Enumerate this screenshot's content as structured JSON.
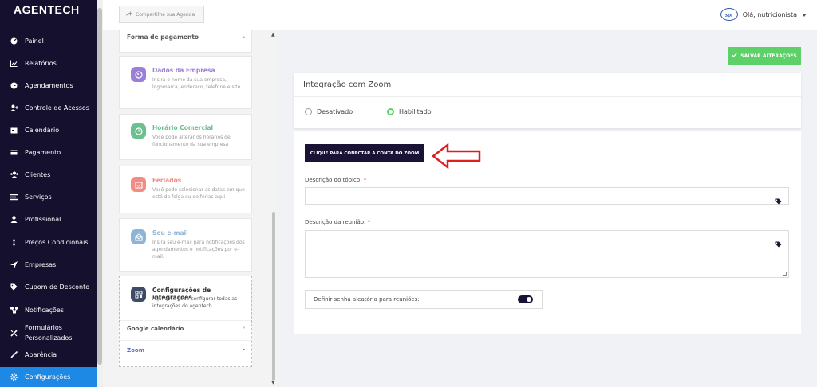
{
  "sidebar": {
    "brand": "AGENTECH",
    "items": [
      {
        "label": "Painel",
        "icon": "dashboard-icon"
      },
      {
        "label": "Relatórios",
        "icon": "chart-icon"
      },
      {
        "label": "Agendamentos",
        "icon": "clock-icon"
      },
      {
        "label": "Controle de Acessos",
        "icon": "user-plus-icon"
      },
      {
        "label": "Calendário",
        "icon": "calendar-icon"
      },
      {
        "label": "Pagamento",
        "icon": "wallet-icon"
      },
      {
        "label": "Clientes",
        "icon": "users-icon"
      },
      {
        "label": "Serviços",
        "icon": "list-icon"
      },
      {
        "label": "Profissional",
        "icon": "person-icon"
      },
      {
        "label": "Preços Condicionais",
        "icon": "dollar-icon"
      },
      {
        "label": "Empresas",
        "icon": "send-icon"
      },
      {
        "label": "Cupom de Desconto",
        "icon": "tag-icon"
      },
      {
        "label": "Notificações",
        "icon": "network-icon"
      },
      {
        "label": "Formulários Personalizados",
        "icon": "form-icon"
      },
      {
        "label": "Aparência",
        "icon": "brush-icon"
      },
      {
        "label": "Configurações",
        "icon": "gear-icon",
        "active": true
      }
    ]
  },
  "header": {
    "share_label": "Compartilhe sua Agenda",
    "logo_text": "spt",
    "greeting": "Olá, nutricionista"
  },
  "settings": {
    "payment": "Forma de pagamento",
    "cards": [
      {
        "title": "Dados da Empresa",
        "desc": "Insira o nome da sua empresa, logomarca, endereço, telefone e site",
        "color": "#9b7fd4"
      },
      {
        "title": "Horário Comercial",
        "desc": "Você pode alterar os horários de funcionamento da sua empresa",
        "color": "#6dbf8f"
      },
      {
        "title": "Feriados",
        "desc": "Você pode selecionar as datas em que está de folga ou de férias aqui",
        "color": "#f28b82"
      },
      {
        "title": "Seu e-mail",
        "desc": "Insira seu e-mail para notificações dos agendamentos e notificações por e-mail.",
        "color": "#8fb5d6"
      }
    ],
    "integrations": {
      "title": "Configurações de integrações",
      "desc": "Aqui você pode configurar todas as integrações do agentech.",
      "color": "#3f4a66",
      "sub": [
        "Google calendário",
        "Zoom"
      ]
    }
  },
  "main": {
    "save_label": "SALVAR ALTERAÇÕES",
    "title": "Integração com Zoom",
    "radio_off": "Desativado",
    "radio_on": "Habilitado",
    "connect_label": "CLIQUE PARA CONECTAR A CONTA DO ZOOM",
    "topic_label": "Descrição do tópico:",
    "meeting_label": "Descrição da reunião:",
    "required_mark": "*",
    "toggle_label": "Definir senha aleatória para reuniões:",
    "toggle_on": true
  },
  "colors": {
    "sidebar_bg": "#14102e",
    "active": "#1e88e5",
    "save": "#5dd068",
    "connect": "#1b1335",
    "annotation_arrow": "#e02020"
  }
}
